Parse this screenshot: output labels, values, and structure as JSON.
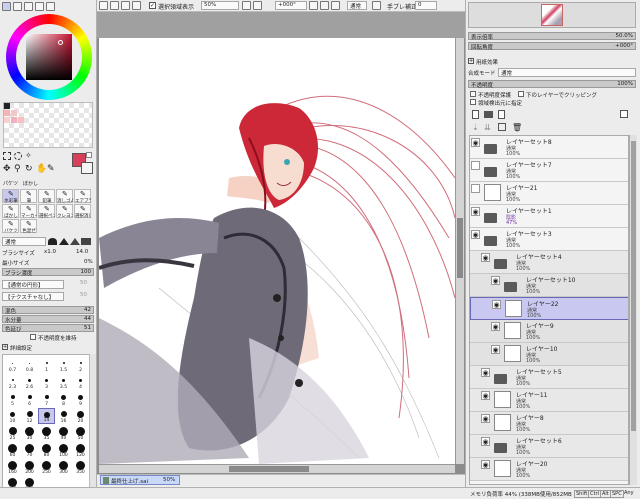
{
  "toolbar": {
    "checkbox_label": "選択領域表示",
    "zoom": "50%",
    "angle": "+000°",
    "blend": "通常",
    "stabilizer_label": "手ブレ補正",
    "stabilizer_value": "0"
  },
  "navigator": {
    "zoom_label": "表示倍率",
    "zoom_value": "50.0%",
    "angle_label": "回転角度",
    "angle_value": "+000°"
  },
  "layer_effects": {
    "title": "用紙効果",
    "blend_label": "合成モード",
    "blend_value": "通常",
    "opacity_label": "不透明度",
    "opacity_value": "100%",
    "protect_label": "不透明度保護",
    "clip_label": "下のレイヤーでクリッピング",
    "select_label": "領域検出元に指定"
  },
  "layers": [
    {
      "name": "レイヤーセット8",
      "mode": "通常",
      "opacity": "100%",
      "type": "folder",
      "indent": 0,
      "eye": true,
      "selected": false,
      "bg": "#f4f4f4"
    },
    {
      "name": "レイヤーセット7",
      "mode": "通常",
      "opacity": "100%",
      "type": "folder",
      "indent": 0,
      "eye": false,
      "selected": false,
      "bg": "#f4f4f4"
    },
    {
      "name": "レイヤー21",
      "mode": "通常",
      "opacity": "100%",
      "type": "layer",
      "indent": 0,
      "eye": false,
      "selected": false,
      "bg": "#f4f4f4"
    },
    {
      "name": "レイヤーセット1",
      "mode": "陰影",
      "opacity": "47%",
      "type": "folder",
      "indent": 0,
      "eye": true,
      "selected": false,
      "bg": "#f4f4f4"
    },
    {
      "name": "レイヤーセット3",
      "mode": "通常",
      "opacity": "100%",
      "type": "folder",
      "indent": 0,
      "eye": true,
      "selected": false,
      "bg": "#f4f4f4"
    },
    {
      "name": "レイヤーセット4",
      "mode": "通常",
      "opacity": "100%",
      "type": "folder",
      "indent": 1,
      "eye": true,
      "selected": false,
      "bg": "#e8e8e8"
    },
    {
      "name": "レイヤーセット10",
      "mode": "通常",
      "opacity": "100%",
      "type": "folder",
      "indent": 2,
      "eye": true,
      "selected": false,
      "bg": "#e2e2e2"
    },
    {
      "name": "レイヤー22",
      "mode": "通常",
      "opacity": "100%",
      "type": "layer",
      "indent": 2,
      "eye": true,
      "selected": true,
      "bg": "#c8c8f0"
    },
    {
      "name": "レイヤー9",
      "mode": "通常",
      "opacity": "100%",
      "type": "layer",
      "indent": 2,
      "eye": true,
      "selected": false,
      "bg": "#e2e2e2"
    },
    {
      "name": "レイヤー10",
      "mode": "通常",
      "opacity": "100%",
      "type": "layer",
      "indent": 2,
      "eye": true,
      "selected": false,
      "bg": "#e2e2e2"
    },
    {
      "name": "レイヤーセット5",
      "mode": "通常",
      "opacity": "100%",
      "type": "folder",
      "indent": 1,
      "eye": true,
      "selected": false,
      "bg": "#e8e8e8"
    },
    {
      "name": "レイヤー11",
      "mode": "通常",
      "opacity": "100%",
      "type": "layer",
      "indent": 1,
      "eye": true,
      "selected": false,
      "bg": "#e8e8e8"
    },
    {
      "name": "レイヤー8",
      "mode": "通常",
      "opacity": "100%",
      "type": "layer",
      "indent": 1,
      "eye": true,
      "selected": false,
      "bg": "#e8e8e8"
    },
    {
      "name": "レイヤーセット6",
      "mode": "通常",
      "opacity": "100%",
      "type": "folder",
      "indent": 1,
      "eye": true,
      "selected": false,
      "bg": "#e8e8e8"
    },
    {
      "name": "レイヤー20",
      "mode": "通常",
      "opacity": "100%",
      "type": "layer",
      "indent": 1,
      "eye": true,
      "selected": false,
      "bg": "#e8e8e8"
    }
  ],
  "tools": {
    "tab_a": "パケツ",
    "tab_b": "ぼかし",
    "row1": [
      "鉛筆",
      "水彩筆",
      "筆"
    ],
    "row2": [
      "エアブラシ",
      "選択ペン",
      "消しゴム"
    ],
    "row3": [
      "キャンバス",
      "選択消し",
      "色混ぜ"
    ],
    "tool_labels": [
      "水彩筆",
      "筆",
      "鉛筆",
      "消しゴム",
      "エアブラシ",
      "ぼかし",
      "マーカー",
      "選択ペン",
      "クレヨン",
      "選択消し",
      "バケツ",
      "色混ぜ"
    ]
  },
  "brush": {
    "blend": "通常",
    "size_label": "ブラシサイズ",
    "size_x": "x1.0",
    "size_value": "14.0",
    "min_label": "最小サイズ",
    "min_value": "0%",
    "density_label": "ブラシ濃度",
    "density_value": "100",
    "shape1": "【通常の円形】",
    "shape2": "【テクスチャなし】",
    "shape_value": "50",
    "mix_label": "混色",
    "mix_value": "42",
    "water_label": "水分量",
    "water_value": "44",
    "persist_label": "色延び",
    "persist_value": "51",
    "keep_opacity": "不透明度を維持",
    "detail_label": "詳細設定"
  },
  "brush_sizes": [
    "0.7",
    "0.8",
    "1",
    "1.5",
    "2",
    "2.3",
    "2.6",
    "3",
    "3.5",
    "4",
    "5",
    "6",
    "7",
    "8",
    "9",
    "10",
    "12",
    "14",
    "16",
    "20",
    "25",
    "30",
    "35",
    "40",
    "50",
    "60",
    "70",
    "80",
    "100",
    "120",
    "160",
    "200",
    "250",
    "300",
    "350",
    "400",
    "500"
  ],
  "canvas": {
    "doc_name": "最終仕上げ.sai",
    "doc_zoom": "50%"
  },
  "statusbar": {
    "memory": "メモリ負荷率 44% (338MB使用/852MB確保)",
    "keys": [
      "Shift",
      "Ctrl",
      "Alt",
      "SPC"
    ],
    "any": "Any"
  },
  "colors": {
    "accent": "#6a6ab4",
    "primary": "#d8405a",
    "secondary": "#f4f4f4"
  }
}
